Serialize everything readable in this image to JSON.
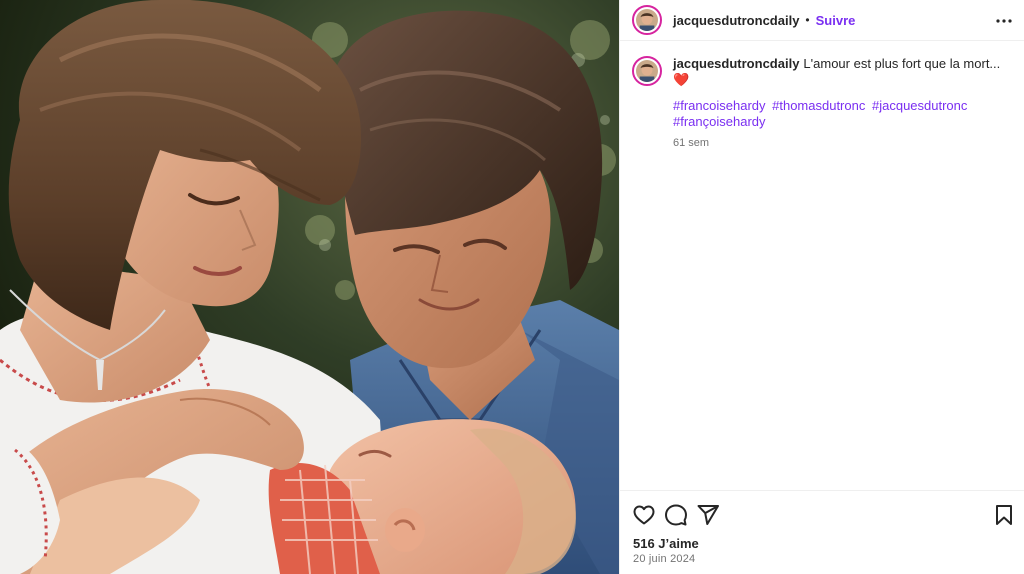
{
  "post": {
    "username": "jacquesdutroncdaily",
    "separator": "•",
    "follow_label": "Suivre",
    "more_icon": "more-options-icon",
    "caption": {
      "username": "jacquesdutroncdaily",
      "text": "L'amour est plus fort que la mort... ❤️",
      "hashtags": [
        "#francoisehardy",
        "#thomasdutronc",
        "#jacquesdutronc",
        "#françoisehardy"
      ],
      "age": "61 sem"
    },
    "actions": {
      "like_icon": "heart-icon",
      "comment_icon": "comment-icon",
      "share_icon": "send-icon",
      "save_icon": "bookmark-icon"
    },
    "likes": "516 J’aime",
    "date": "20 juin 2024"
  },
  "colors": {
    "accent": "#7a2ff1",
    "avatar_ring": "#d6249f",
    "heart": "#e0241b"
  }
}
